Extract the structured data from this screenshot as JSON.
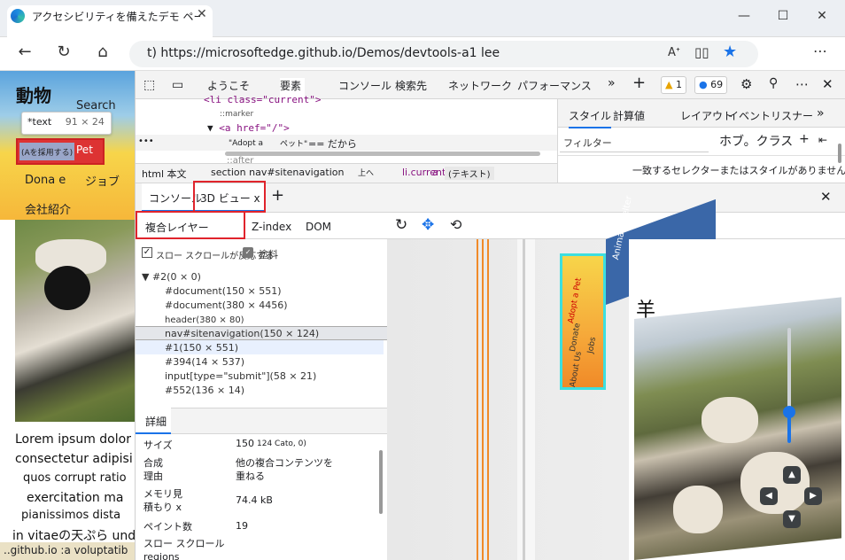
{
  "browser": {
    "tab_title": "アクセシビリティを備えたデモ ページは次の操作を行います。",
    "url": "t) https://microsoftedge.github.io/Demos/devtools-a1 lee"
  },
  "page": {
    "site_title": "動物",
    "search_label": "Search",
    "tooltip_text": "*text",
    "tooltip_dims": "91 × 24",
    "adopt_label": "(Aを採用する)",
    "pet_label": "Pet",
    "donate_label": "Dona e",
    "jobs_label": "ジョブ",
    "about_label": "会社紹介",
    "lorem_lines": [
      "Lorem ipsum dolor",
      "consectetur adipisi",
      "quos corrupt ratio",
      "exercitation ma",
      "pianissimos dista",
      "in vitaeの天ぷら unde"
    ],
    "status_text": "..github.io :a voluptatib"
  },
  "devtools": {
    "main_tabs": [
      "ようこそ",
      "要素",
      "コンソール",
      "検索先",
      "ネットワーク",
      "パフォーマンス"
    ],
    "more_tabs": "»",
    "add_tab": "+",
    "warnings_count": "1",
    "issues_count": "69",
    "elements_code": {
      "line1": "<li class=\"current\">",
      "line2": "::marker",
      "line3_tag": "<a href=\"/\">",
      "line4": "\"Adopt a",
      "line4b": "ペット\"",
      "line4c": "== だから",
      "line5": "::after"
    },
    "breadcrumbs": [
      "html 本文",
      "section nav#sitenavigation",
      "上へ",
      "li.current",
      "a",
      "(テキスト)"
    ],
    "styles_tabs": [
      "スタイル",
      "計算値",
      "レイアウト",
      "イベントリスナー"
    ],
    "filter_placeholder": "フィルター",
    "hov_cls": "ホブ。クラス",
    "no_match": "一致するセレクターまたはスタイルがありません",
    "drawer_tabs": [
      "コンソール",
      "3D ビュー x"
    ],
    "subtabs": [
      "複合レイヤー",
      "Z-index",
      "DOM"
    ],
    "slow_scroll_label": "スロー スクロールが反応する",
    "paint_label": "塗料",
    "tree": [
      "#2(0 × 0)",
      "#document(150 × 551)",
      "#document(380 × 4456)",
      "header(380 × 80)",
      "nav#sitenavigation(150 × 124)",
      "#1(150 × 551)",
      "#394(14 × 537)",
      "input[type=\"submit\"](58 × 21)",
      "#552(136 × 14)"
    ],
    "details_tab": "詳細",
    "details": [
      {
        "key": "サイズ",
        "value": "150",
        "extra": "124 Cato, 0)"
      },
      {
        "key": "合成\n理由",
        "value": "他の複合コンテンツを\n重ねる"
      },
      {
        "key": "メモリ見\n積もり x",
        "value": "74.4 kB"
      },
      {
        "key": "ペイント数",
        "value": "19"
      },
      {
        "key": "スロー スクロール\nregions",
        "value": ""
      }
    ],
    "scene_card_text": [
      "Adopt a Pet",
      "Donate",
      "Jobs",
      "About Us"
    ],
    "scene_header_text": "Animal Shelter",
    "scene_title": "羊"
  }
}
